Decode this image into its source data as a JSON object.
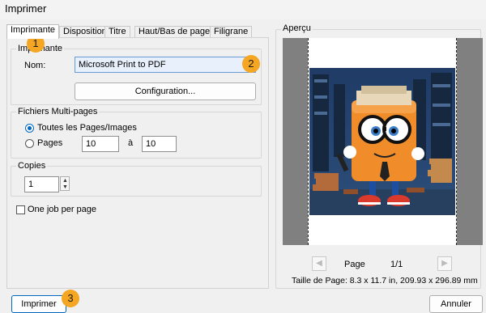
{
  "window": {
    "title": "Imprimer",
    "close_glyph": "✕"
  },
  "tabs": [
    {
      "label": "Imprimante"
    },
    {
      "label": "Disposition"
    },
    {
      "label": "Titre"
    },
    {
      "label": "Haut/Bas de page"
    },
    {
      "label": "Filigrane"
    }
  ],
  "printer": {
    "group_label": "Imprimante",
    "name_label": "Nom:",
    "name_value": "Microsoft Print to PDF",
    "config_button": "Configuration..."
  },
  "multipage": {
    "group_label": "Fichiers Multi-pages",
    "all_pages_label": "Toutes les Pages/Images",
    "pages_label": "Pages",
    "from_value": "10",
    "to_label": "à",
    "to_value": "10",
    "selected": "all"
  },
  "copies": {
    "group_label": "Copies",
    "value": "1"
  },
  "one_job": {
    "label": "One job per page",
    "checked": false
  },
  "preview": {
    "group_label": "Aperçu",
    "page_label": "Page",
    "page_count": "1/1",
    "page_size": "Taille de Page: 8.3 x 11.7 in, 209.93 x 296.89 mm"
  },
  "buttons": {
    "print": "Imprimer",
    "cancel": "Annuler"
  },
  "badges": [
    "1",
    "2",
    "3"
  ],
  "colors": {
    "accent": "#0067c0",
    "badge": "#f5a623"
  }
}
